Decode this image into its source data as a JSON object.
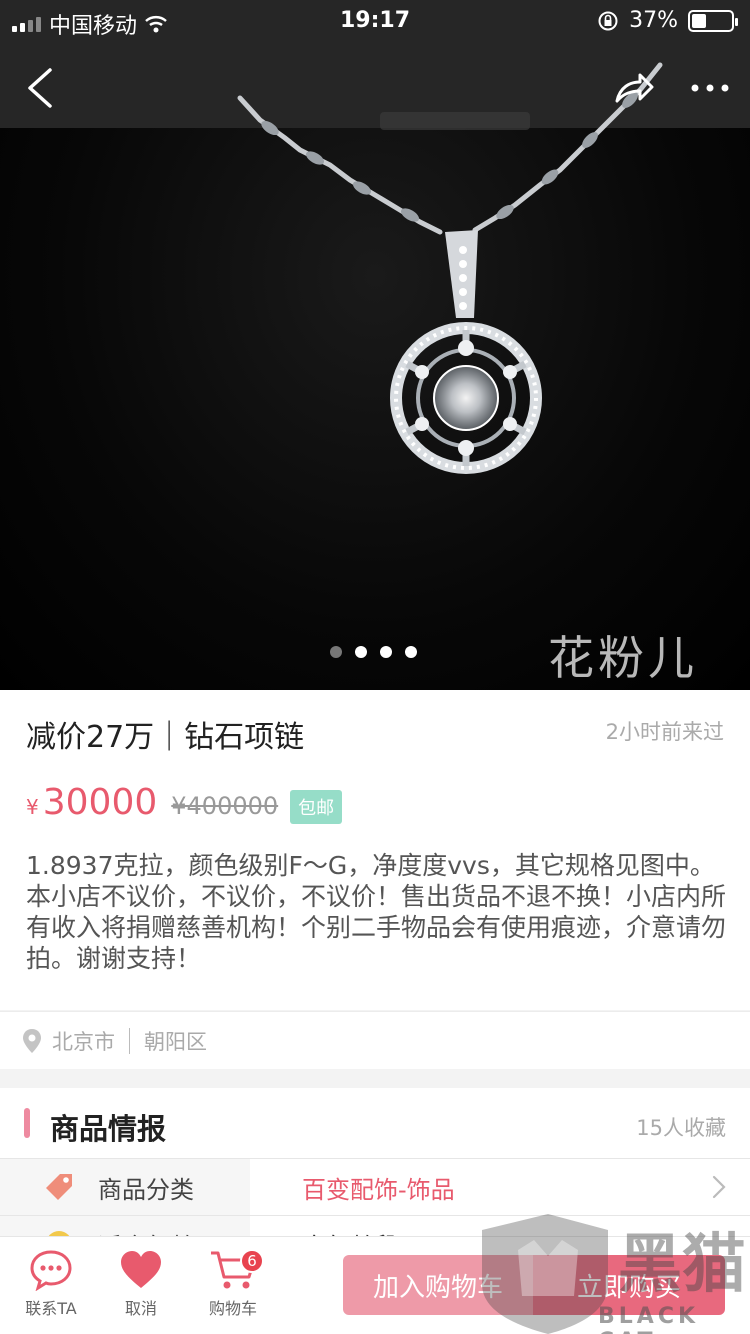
{
  "status_bar": {
    "carrier": "中国移动",
    "time": "19:17",
    "battery": "37%",
    "battery_level": 0.37
  },
  "hero": {
    "watermark": "花粉儿",
    "pages": 4,
    "active_page": 0
  },
  "product": {
    "title": "减价27万｜钻石项链",
    "last_visit": "2小时前来过",
    "currency": "¥",
    "price": "30000",
    "original_price": "¥400000",
    "shipping_badge": "包邮",
    "description": "1.8937克拉，颜色级别F～G，净度度vvs，其它规格见图中。本小店不议价，不议价，不议价！售出货品不退不换！小店内所有收入将捐赠慈善机构！个别二手物品会有使用痕迹，介意请勿拍。谢谢支持！"
  },
  "location": {
    "city": "北京市",
    "district": "朝阳区"
  },
  "info_section": {
    "title": "商品情报",
    "favorites": "15人收藏",
    "rows": [
      {
        "label": "商品分类",
        "value": "百变配饰-饰品"
      },
      {
        "label": "适合年龄",
        "value": "全年龄段"
      }
    ]
  },
  "bottom_bar": {
    "contact": "联系TA",
    "cancel": "取消",
    "cart": "购物车",
    "cart_count": "6",
    "add_to_cart": "加入购物车",
    "buy_now": "立即购买"
  },
  "corner_watermark": {
    "text": "BLACK CAT",
    "logo": "黑猫"
  },
  "colors": {
    "accent": "#e85a6d",
    "accent_light": "#ee9aa8",
    "badge_green": "#96ddc8",
    "section_bar": "#ee8aa0"
  }
}
